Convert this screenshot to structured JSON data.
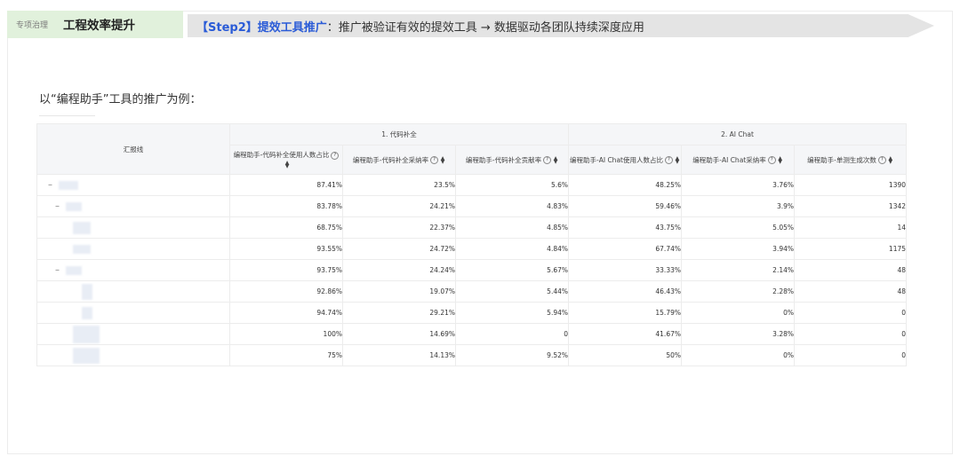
{
  "header": {
    "category": "专项治理",
    "title": "工程效率提升",
    "step_highlight": "【Step2】提效工具推广",
    "step_rest": "：推广被验证有效的提效工具 → 数据驱动各团队持续深度应用"
  },
  "subtitle": "以“编程助手”工具的推广为例：",
  "table": {
    "row_header": "汇报线",
    "groups": [
      "1. 代码补全",
      "2. AI Chat"
    ],
    "columns": [
      "编程助手-代码补全使用人数占比",
      "编程助手-代码补全采纳率",
      "编程助手-代码补全贡献率",
      "编程助手-AI Chat使用人数占比",
      "编程助手-AI Chat采纳率",
      "编程助手-单测生成次数"
    ],
    "rows": [
      [
        "87.41%",
        "23.5%",
        "5.6%",
        "48.25%",
        "3.76%",
        "1390"
      ],
      [
        "83.78%",
        "24.21%",
        "4.83%",
        "59.46%",
        "3.9%",
        "1342"
      ],
      [
        "68.75%",
        "22.37%",
        "4.85%",
        "43.75%",
        "5.05%",
        "14"
      ],
      [
        "93.55%",
        "24.72%",
        "4.84%",
        "67.74%",
        "3.94%",
        "1175"
      ],
      [
        "93.75%",
        "24.24%",
        "5.67%",
        "33.33%",
        "2.14%",
        "48"
      ],
      [
        "92.86%",
        "19.07%",
        "5.44%",
        "46.43%",
        "2.28%",
        "48"
      ],
      [
        "94.74%",
        "29.21%",
        "5.94%",
        "15.79%",
        "0%",
        "0"
      ],
      [
        "100%",
        "14.69%",
        "0",
        "41.67%",
        "3.28%",
        "0"
      ],
      [
        "75%",
        "14.13%",
        "9.52%",
        "50%",
        "0%",
        "0"
      ]
    ],
    "colors": {
      "header_bg": "#f5f6f8",
      "border": "#ececec",
      "accent": "#2a5bd7",
      "tag_bg": "#e1f1dc",
      "banner_bg": "#e4e4e4"
    }
  }
}
